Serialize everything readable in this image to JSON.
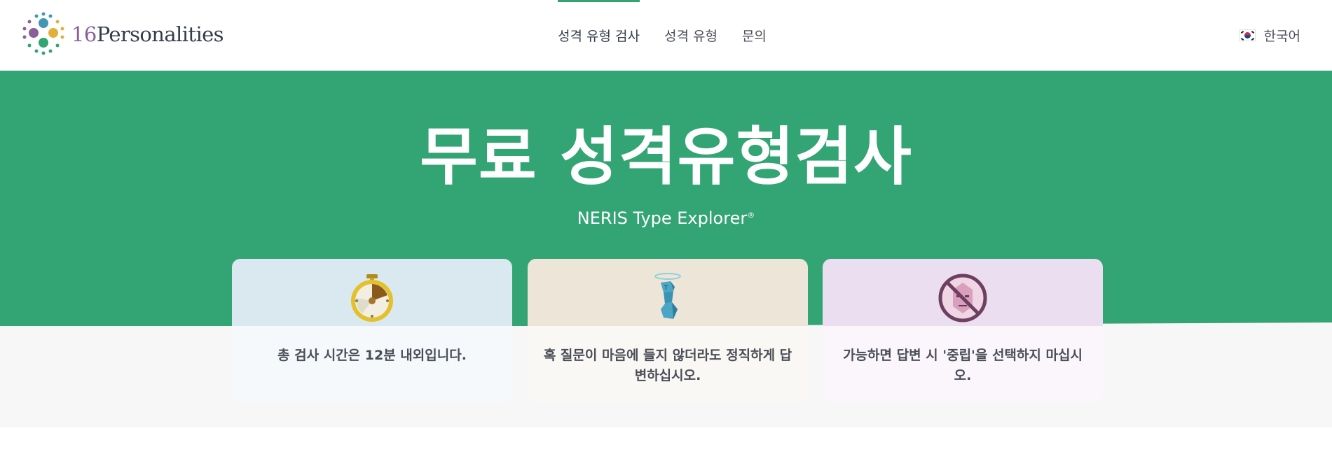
{
  "header": {
    "logo": {
      "number": "16",
      "word": "Personalities"
    },
    "nav": [
      {
        "label": "성격 유형 검사",
        "active": true
      },
      {
        "label": "성격 유형",
        "active": false
      },
      {
        "label": "문의",
        "active": false
      }
    ],
    "language": {
      "label": "한국어",
      "flag_icon": "korea-flag-icon"
    }
  },
  "hero": {
    "title": "무료 성격유형검사",
    "subtitle": "NERIS Type Explorer",
    "subtitle_mark": "®",
    "background_color": "#33a474"
  },
  "cards": [
    {
      "icon": "stopwatch-icon",
      "text": "총 검사 시간은 12분 내외입니다.",
      "color": "#d9e9ef"
    },
    {
      "icon": "angel-character-icon",
      "text": "혹 질문이 마음에 들지 않더라도 정직하게 답변하십시오.",
      "color": "#ede5d8"
    },
    {
      "icon": "no-neutral-face-icon",
      "text": "가능하면 답변 시 '중립'을 선택하지 마십시오.",
      "color": "#ebdef1"
    }
  ]
}
